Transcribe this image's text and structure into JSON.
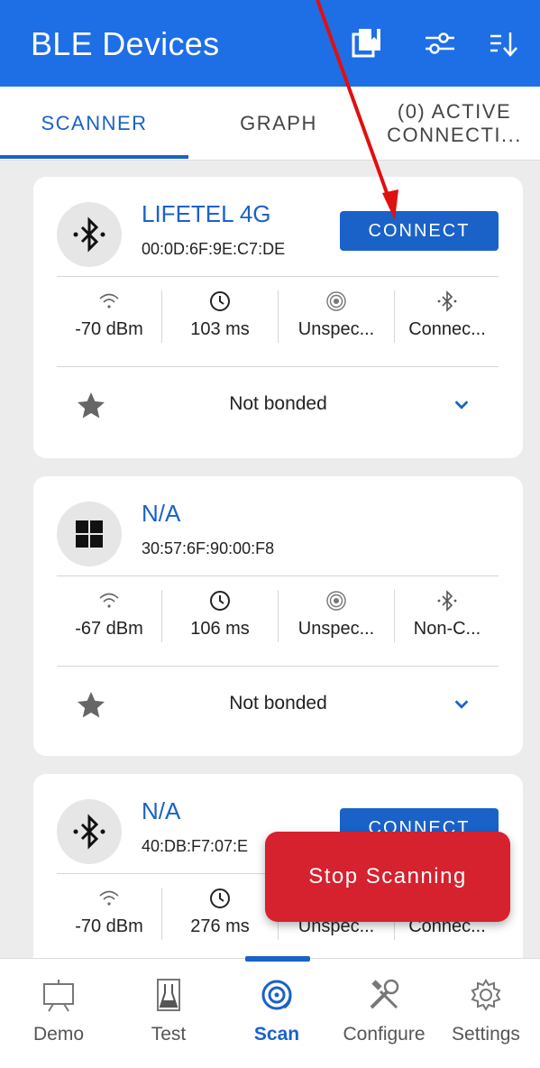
{
  "appbar": {
    "title": "BLE Devices",
    "icons": [
      "bookmark-icon",
      "filter-sliders-icon",
      "sort-icon"
    ]
  },
  "tabs": [
    {
      "label": "SCANNER",
      "active": true
    },
    {
      "label": "GRAPH",
      "active": false
    },
    {
      "label_line1": "(0) ACTIVE",
      "label_line2": "CONNECTI...",
      "active": false
    }
  ],
  "devices": [
    {
      "name": "LIFETEL 4G",
      "address": "00:0D:6F:9E:C7:DE",
      "icon": "bluetooth-icon",
      "connect_label": "CONNECT",
      "rssi": "-70 dBm",
      "interval": "103 ms",
      "beacon": "Unspec...",
      "connectable": "Connec...",
      "bond_status": "Not bonded"
    },
    {
      "name": "N/A",
      "address": "30:57:6F:90:00:F8",
      "icon": "windows-icon",
      "rssi": "-67 dBm",
      "interval": "106 ms",
      "beacon": "Unspec...",
      "connectable": "Non-C...",
      "bond_status": "Not bonded"
    },
    {
      "name": "N/A",
      "address": "40:DB:F7:07:E",
      "icon": "bluetooth-icon",
      "connect_label": "CONNECT",
      "rssi": "-70 dBm",
      "interval": "276 ms",
      "beacon": "Unspec...",
      "connectable": "Connec..."
    }
  ],
  "fab": {
    "label": "Stop Scanning",
    "color": "#d6212e"
  },
  "bottom_nav": [
    {
      "label": "Demo",
      "icon": "presentation-icon"
    },
    {
      "label": "Test",
      "icon": "flask-icon"
    },
    {
      "label": "Scan",
      "icon": "scan-target-icon",
      "active": true
    },
    {
      "label": "Configure",
      "icon": "tools-icon"
    },
    {
      "label": "Settings",
      "icon": "gear-icon"
    }
  ],
  "colors": {
    "primary": "#1e6ee6",
    "accent_text": "#1a62c8",
    "annotation_arrow": "#e01010"
  }
}
